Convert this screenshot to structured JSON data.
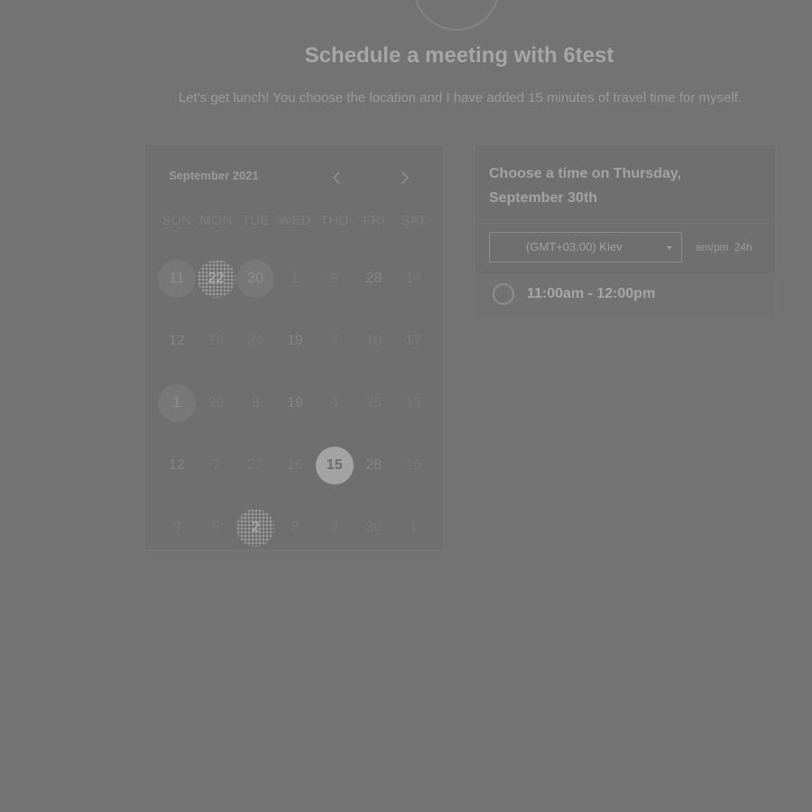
{
  "header": {
    "title": "Schedule a meeting with 6test",
    "description": "Let's get lunch! You choose the location and I have added 15 minutes of travel time for myself."
  },
  "calendar": {
    "month_label": "September 2021",
    "prev_icon": "chevron-left-icon",
    "next_icon": "chevron-right-icon",
    "weekdays": [
      "SUN",
      "MON",
      "TUE",
      "WED",
      "THU",
      "FRI",
      "SAT"
    ],
    "weeks": [
      [
        {
          "d": "11",
          "s": "avail"
        },
        {
          "d": "22",
          "s": "dotted"
        },
        {
          "d": "30",
          "s": "avail"
        },
        {
          "d": "1",
          "s": "none"
        },
        {
          "d": "9",
          "s": "none"
        },
        {
          "d": "28",
          "s": "plain"
        },
        {
          "d": "14",
          "s": "none"
        }
      ],
      [
        {
          "d": "12",
          "s": "plain"
        },
        {
          "d": "16",
          "s": "none"
        },
        {
          "d": "24",
          "s": "none"
        },
        {
          "d": "19",
          "s": "plain"
        },
        {
          "d": "7",
          "s": "none"
        },
        {
          "d": "10",
          "s": "none"
        },
        {
          "d": "17",
          "s": "none"
        }
      ],
      [
        {
          "d": "1",
          "s": "avail"
        },
        {
          "d": "29",
          "s": "none"
        },
        {
          "d": "8",
          "s": "none"
        },
        {
          "d": "19",
          "s": "plain"
        },
        {
          "d": "4",
          "s": "none"
        },
        {
          "d": "25",
          "s": "none"
        },
        {
          "d": "15",
          "s": "none"
        }
      ],
      [
        {
          "d": "12",
          "s": "plain"
        },
        {
          "d": "7",
          "s": "none"
        },
        {
          "d": "27",
          "s": "none"
        },
        {
          "d": "16",
          "s": "none"
        },
        {
          "d": "15",
          "s": "selected"
        },
        {
          "d": "28",
          "s": "plain"
        },
        {
          "d": "15",
          "s": "none"
        }
      ],
      [
        {
          "d": "9",
          "s": "none"
        },
        {
          "d": "9",
          "s": "none"
        },
        {
          "d": "2",
          "s": "dotted"
        },
        {
          "d": "8",
          "s": "none"
        },
        {
          "d": "2",
          "s": "none"
        },
        {
          "d": "30",
          "s": "none"
        },
        {
          "d": "1",
          "s": "none"
        }
      ]
    ]
  },
  "time_panel": {
    "heading": "Choose a time on Thursday, September 30th",
    "timezone": "(GMT+03:00) Kiev",
    "format_12h": "am/pm",
    "format_24h": "24h",
    "slots": [
      {
        "label": "11:00am - 12:00pm"
      }
    ]
  }
}
